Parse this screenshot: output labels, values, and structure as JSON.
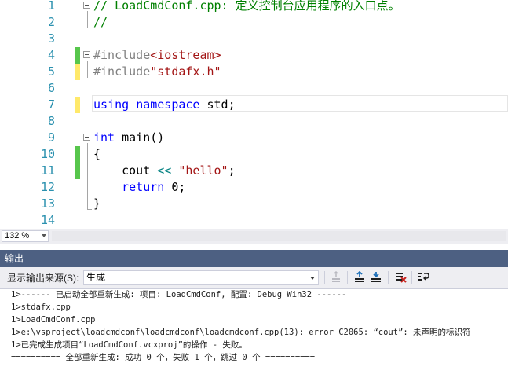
{
  "editor": {
    "lines": [
      {
        "num": "1",
        "tokens": [
          {
            "t": "// LoadCmdConf.cpp: 定义控制台应用程序的入口点。",
            "c": "comment"
          }
        ]
      },
      {
        "num": "2",
        "tokens": [
          {
            "t": "//",
            "c": "comment"
          }
        ]
      },
      {
        "num": "3",
        "tokens": []
      },
      {
        "num": "4",
        "tokens": [
          {
            "t": "#include",
            "c": "pp"
          },
          {
            "t": "<iostream>",
            "c": "str"
          }
        ]
      },
      {
        "num": "5",
        "tokens": [
          {
            "t": "#include",
            "c": "pp"
          },
          {
            "t": "\"stdafx.h\"",
            "c": "str"
          }
        ]
      },
      {
        "num": "6",
        "tokens": []
      },
      {
        "num": "7",
        "tokens": [
          {
            "t": "using",
            "c": "kw"
          },
          {
            "t": " ",
            "c": ""
          },
          {
            "t": "namespace",
            "c": "kw"
          },
          {
            "t": " std;",
            "c": ""
          }
        ]
      },
      {
        "num": "8",
        "tokens": []
      },
      {
        "num": "9",
        "tokens": [
          {
            "t": "int",
            "c": "kw"
          },
          {
            "t": " main()",
            "c": ""
          }
        ]
      },
      {
        "num": "10",
        "tokens": [
          {
            "t": "{",
            "c": ""
          }
        ]
      },
      {
        "num": "11",
        "tokens": [
          {
            "t": "    cout ",
            "c": ""
          },
          {
            "t": "<<",
            "c": "op"
          },
          {
            "t": " ",
            "c": ""
          },
          {
            "t": "\"hello\"",
            "c": "str"
          },
          {
            "t": ";",
            "c": ""
          }
        ]
      },
      {
        "num": "12",
        "tokens": [
          {
            "t": "    ",
            "c": ""
          },
          {
            "t": "return",
            "c": "kw"
          },
          {
            "t": " 0;",
            "c": ""
          }
        ]
      },
      {
        "num": "13",
        "tokens": [
          {
            "t": "}",
            "c": ""
          }
        ]
      },
      {
        "num": "14",
        "tokens": []
      }
    ],
    "zoom": "132 %"
  },
  "output": {
    "title": "输出",
    "source_label": "显示输出来源(S):",
    "source_value": "生成",
    "lines": [
      "1>------ 已启动全部重新生成: 项目: LoadCmdConf, 配置: Debug Win32 ------",
      "1>stdafx.cpp",
      "1>LoadCmdConf.cpp",
      "1>e:\\vsproject\\loadcmdconf\\loadcmdconf\\loadcmdconf.cpp(13): error C2065: “cout”: 未声明的标识符",
      "1>已完成生成项目“LoadCmdConf.vcxproj”的操作 - 失败。",
      "========== 全部重新生成: 成功 0 个，失败 1 个，跳过 0 个 =========="
    ]
  },
  "colors": {
    "panel_header": "#4d6082",
    "change_saved": "#57c64c",
    "change_unsaved": "#ffe96a"
  }
}
